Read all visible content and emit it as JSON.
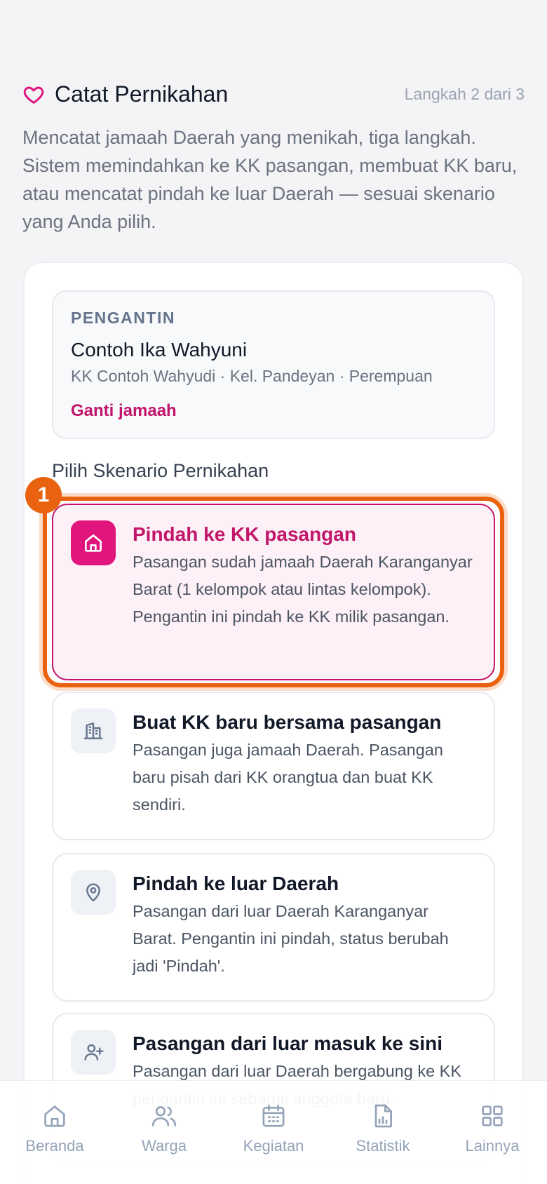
{
  "header": {
    "icon": "heart-icon",
    "title": "Catat Pernikahan",
    "step": "Langkah 2 dari 3",
    "description": "Mencatat jamaah Daerah yang menikah, tiga langkah. Sistem memindahkan ke KK pasangan, membuat KK baru, atau mencatat pindah ke luar Daerah — sesuai skenario yang Anda pilih."
  },
  "bride": {
    "caption": "PENGANTIN",
    "name": "Contoh Ika Wahyuni",
    "meta": "KK Contoh Wahyudi · Kel. Pandeyan · Perempuan",
    "change_label": "Ganti jamaah"
  },
  "scenario_label": "Pilih Skenario Pernikahan",
  "marker": "1",
  "options": [
    {
      "icon": "home-icon",
      "title": "Pindah ke KK pasangan",
      "description": "Pasangan sudah jamaah Daerah Karanganyar Barat (1 kelompok atau lintas kelompok). Pengantin ini pindah ke KK milik pasangan.",
      "selected": true
    },
    {
      "icon": "building-icon",
      "title": "Buat KK baru bersama pasangan",
      "description": "Pasangan juga jamaah Daerah. Pasangan baru pisah dari KK orangtua dan buat KK sendiri.",
      "selected": false
    },
    {
      "icon": "map-pin-icon",
      "title": "Pindah ke luar Daerah",
      "description": "Pasangan dari luar Daerah Karanganyar Barat. Pengantin ini pindah, status berubah jadi 'Pindah'.",
      "selected": false
    },
    {
      "icon": "user-plus-icon",
      "title": "Pasangan dari luar masuk ke sini",
      "description": "Pasangan dari luar Daerah bergabung ke KK pengantin ini sebagai anggota baru.",
      "selected": false
    }
  ],
  "nav": [
    {
      "icon": "home-icon",
      "label": "Beranda"
    },
    {
      "icon": "users-icon",
      "label": "Warga"
    },
    {
      "icon": "calendar-icon",
      "label": "Kegiatan"
    },
    {
      "icon": "chart-icon",
      "label": "Statistik"
    },
    {
      "icon": "grid-icon",
      "label": "Lainnya"
    }
  ],
  "colors": {
    "accent": "#c2166b",
    "accent_bg": "#e0157e",
    "highlight": "#e8620f",
    "muted": "#94a3b8"
  }
}
